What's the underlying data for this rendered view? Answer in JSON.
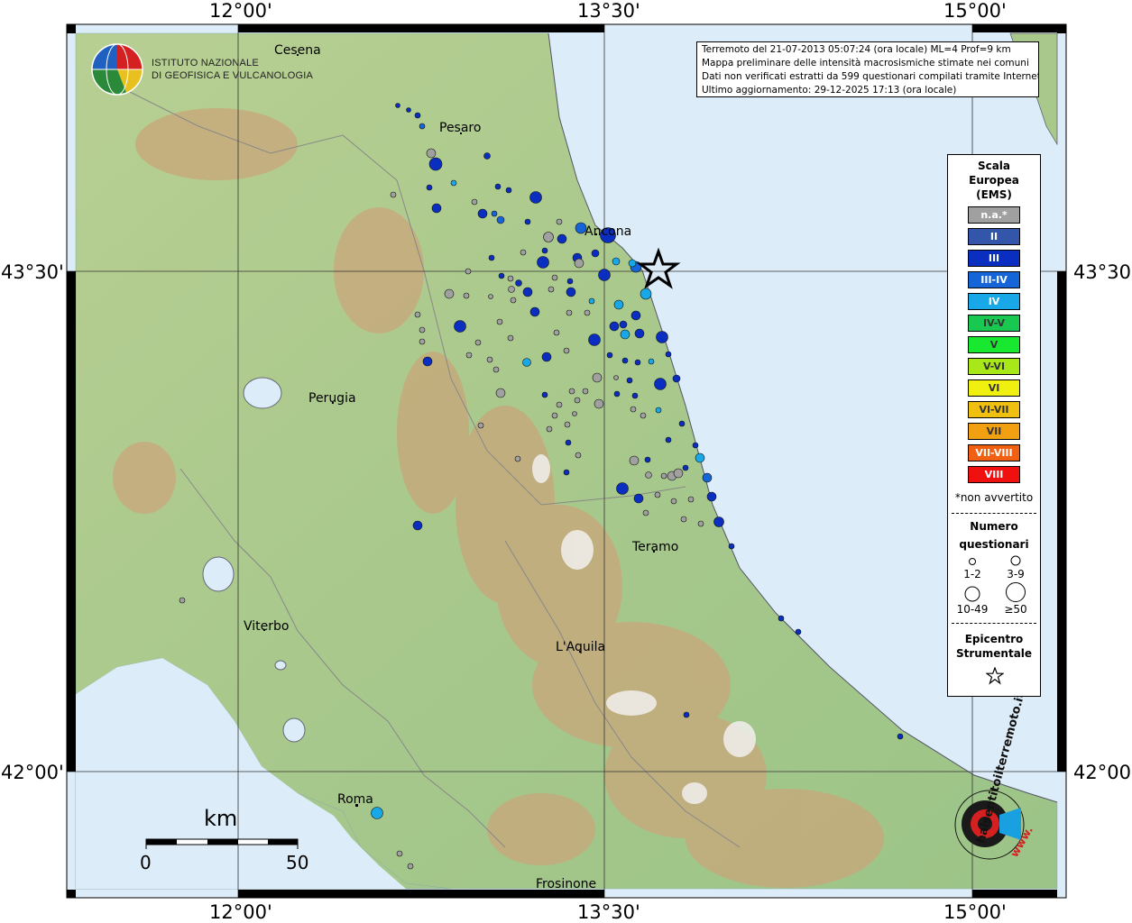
{
  "header": {
    "institute_line1": "ISTITUTO NAZIONALE",
    "institute_line2": "DI GEOFISICA E VULCANOLOGIA"
  },
  "info": {
    "line1": "Terremoto del 21-07-2013 05:07:24 (ora locale) ML=4 Prof=9 km",
    "line2": "Mappa preliminare delle intensità macrosismiche stimate nei comuni",
    "line3": "Dati non verificati estratti da 599 questionari compilati tramite Internet.",
    "line4": "Ultimo aggiornamento: 29-12-2025 17:13 (ora locale)"
  },
  "axes": {
    "lon_labels": [
      "12°00'",
      "13°30'",
      "15°00'"
    ],
    "lat_labels": [
      "43°30'",
      "42°00'"
    ]
  },
  "cities": [
    "Cesena",
    "Pesaro",
    "Ancona",
    "Perugia",
    "Teramo",
    "Viterbo",
    "L'Aquila",
    "Roma",
    "Frosinone"
  ],
  "scale_bar": {
    "unit": "km",
    "start": "0",
    "end": "50"
  },
  "legend": {
    "title_line1": "Scala",
    "title_line2": "Europea",
    "title_line3": "(EMS)",
    "items": [
      {
        "label": "n.a.*",
        "color": "#a0a0a0"
      },
      {
        "label": "II",
        "color": "#3355aa"
      },
      {
        "label": "III",
        "color": "#0a2fc0"
      },
      {
        "label": "III-IV",
        "color": "#1565d8"
      },
      {
        "label": "IV",
        "color": "#18a8e8"
      },
      {
        "label": "IV-V",
        "color": "#18c850"
      },
      {
        "label": "V",
        "color": "#18e830"
      },
      {
        "label": "V-VI",
        "color": "#a8e818"
      },
      {
        "label": "VI",
        "color": "#f0f010"
      },
      {
        "label": "VI-VII",
        "color": "#f0c010"
      },
      {
        "label": "VII",
        "color": "#f0a010"
      },
      {
        "label": "VII-VIII",
        "color": "#f06010"
      },
      {
        "label": "VIII",
        "color": "#f01010"
      }
    ],
    "note": "*non avvertito",
    "count_title_line1": "Numero",
    "count_title_line2": "questionari",
    "count_labels": [
      "1-2",
      "3-9",
      "10-49",
      "≥50"
    ],
    "epicenter_line1": "Epicentro",
    "epicenter_line2": "Strumentale"
  },
  "watermark": {
    "text": "haisentitoilterremoto.it",
    "url": "www."
  },
  "colors": {
    "sea": "#dcecf8",
    "land_low": "#9cc488",
    "land_mid": "#b4cc8c",
    "mountain": "#c8a878",
    "peak": "#f0f0f0"
  }
}
